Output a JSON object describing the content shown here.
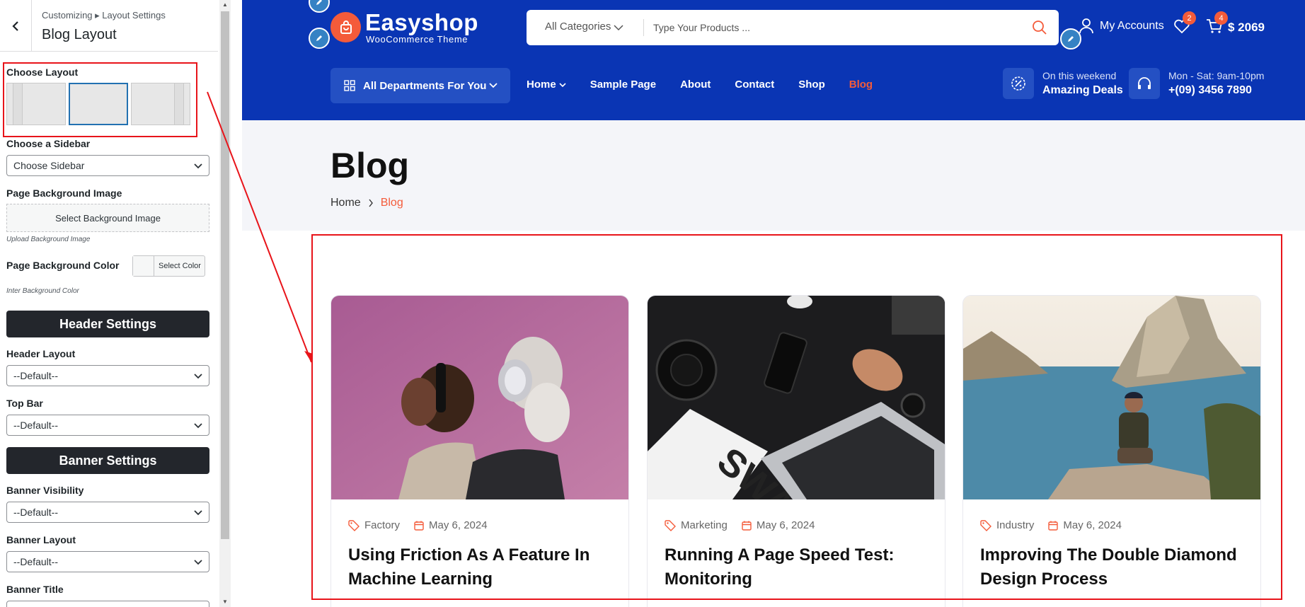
{
  "customizer": {
    "breadcrumb": "Customizing ▸ Layout Settings",
    "title": "Blog Layout",
    "choose_layout_label": "Choose Layout",
    "layout_options": [
      "left-sidebar",
      "no-sidebar",
      "right-sidebar"
    ],
    "layout_selected": "no-sidebar",
    "choose_sidebar_label": "Choose a Sidebar",
    "choose_sidebar_value": "Choose Sidebar",
    "page_bg_image_label": "Page Background Image",
    "select_bg_image_button": "Select Background Image",
    "upload_bg_image_note": "Upload Background Image",
    "page_bg_color_label": "Page Background Color",
    "select_color_button": "Select Color",
    "bg_color_note": "Inter Background Color",
    "header_settings_heading": "Header Settings",
    "header_layout_label": "Header Layout",
    "header_layout_value": "--Default--",
    "top_bar_label": "Top Bar",
    "top_bar_value": "--Default--",
    "banner_settings_heading": "Banner Settings",
    "banner_visibility_label": "Banner Visibility",
    "banner_visibility_value": "--Default--",
    "banner_layout_label": "Banner Layout",
    "banner_layout_value": "--Default--",
    "banner_title_label": "Banner Title"
  },
  "site": {
    "logo_name": "Easyshop",
    "logo_tagline": "WooCommerce Theme",
    "search_category": "All Categories",
    "search_placeholder": "Type Your Products ...",
    "accounts_label": "My Accounts",
    "wishlist_count": "2",
    "cart_count": "4",
    "cart_total": "$ 2069",
    "departments_label": "All Departments For You",
    "nav": [
      {
        "label": "Home",
        "has_dropdown": true
      },
      {
        "label": "Sample Page"
      },
      {
        "label": "About"
      },
      {
        "label": "Contact"
      },
      {
        "label": "Shop"
      },
      {
        "label": "Blog",
        "active": true
      }
    ],
    "deals_small": "On this weekend",
    "deals_big": "Amazing Deals",
    "hours_small": "Mon - Sat: 9am-10pm",
    "hours_phone": "+(09) 3456 7890",
    "accent_color": "#f45b3a",
    "header_color": "#0a35b4"
  },
  "page": {
    "title": "Blog",
    "breadcrumb_home": "Home",
    "breadcrumb_current": "Blog"
  },
  "posts": [
    {
      "category": "Factory",
      "date": "May 6, 2024",
      "title": "Using Friction As A Feature In Machine Learning"
    },
    {
      "category": "Marketing",
      "date": "May 6, 2024",
      "title": "Running A Page Speed Test: Monitoring"
    },
    {
      "category": "Industry",
      "date": "May 6, 2024",
      "title": "Improving The Double Diamond Design Process"
    }
  ]
}
